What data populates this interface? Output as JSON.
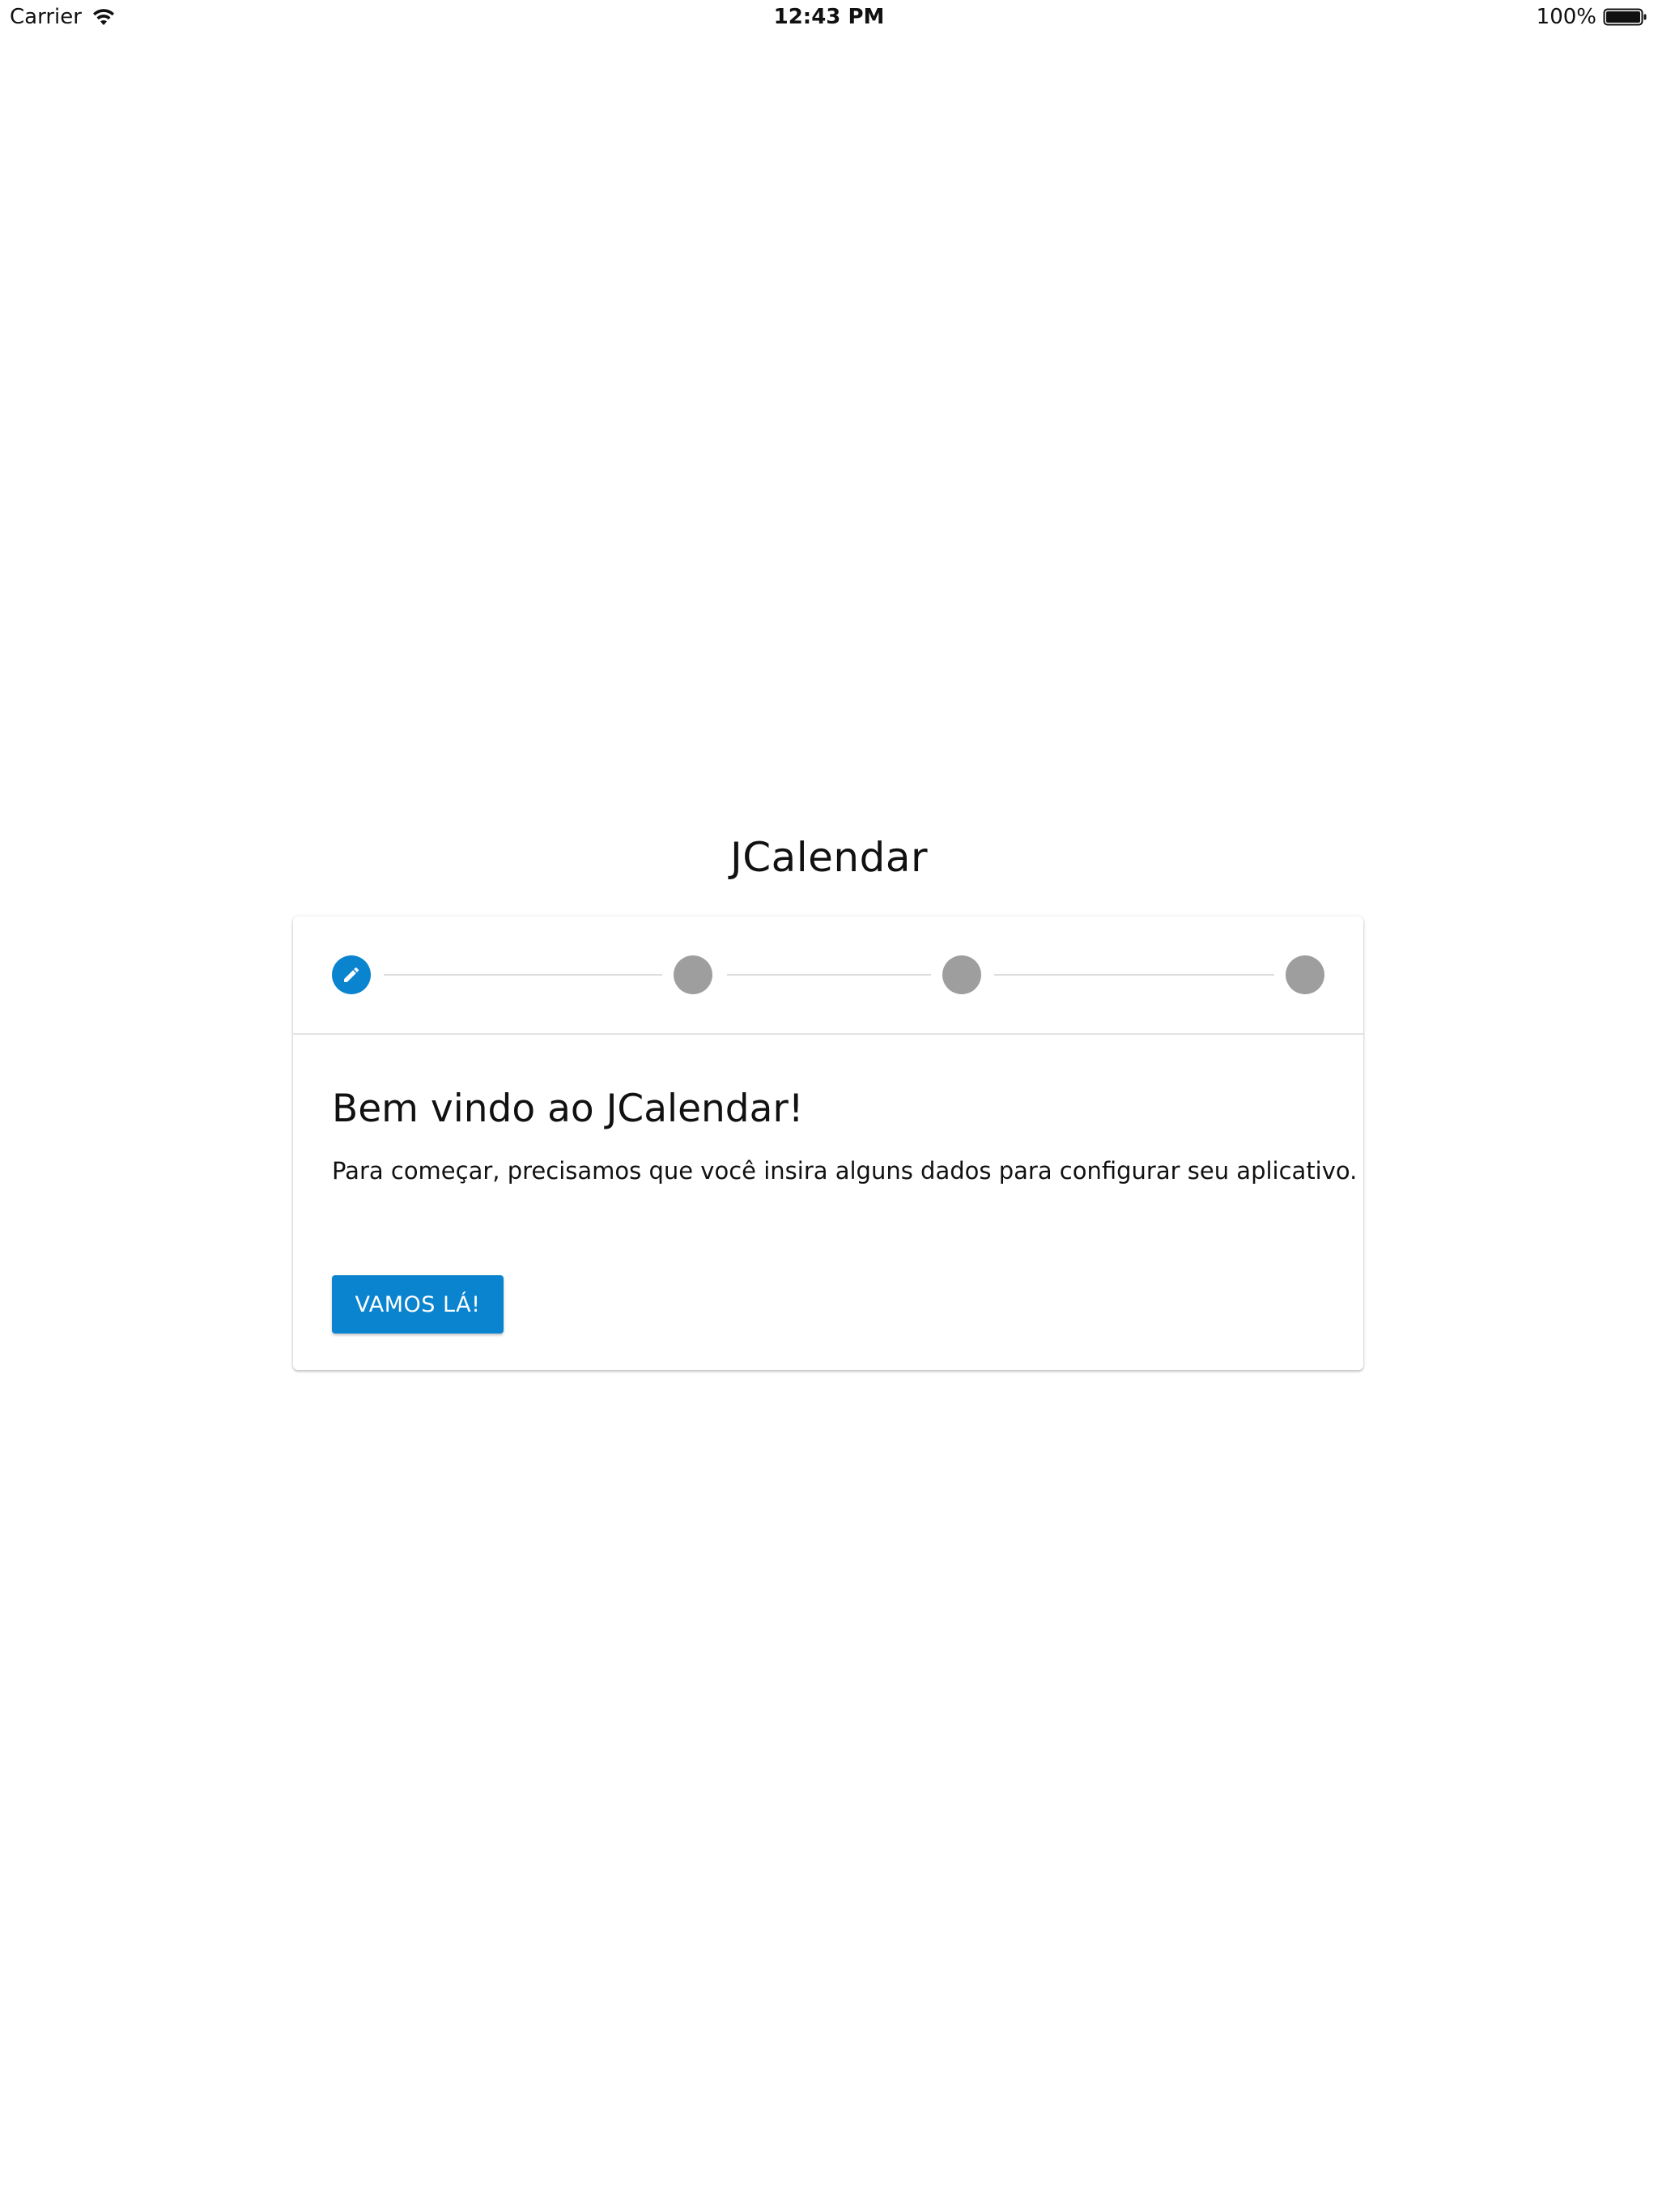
{
  "status_bar": {
    "carrier": "Carrier",
    "time": "12:43 PM",
    "battery": "100%"
  },
  "app": {
    "title": "JCalendar"
  },
  "stepper": {
    "steps": [
      {
        "state": "active",
        "icon": "pencil-icon"
      },
      {
        "state": "inactive"
      },
      {
        "state": "inactive"
      },
      {
        "state": "inactive"
      }
    ]
  },
  "welcome": {
    "heading": "Bem vindo ao JCalendar!",
    "text": "Para começar, precisamos que você insira alguns dados para configurar seu aplicativo.",
    "button_label": "VAMOS LÁ!"
  },
  "colors": {
    "accent": "#0a84cf",
    "step_inactive": "#9e9e9e",
    "divider": "#e3e3e3"
  }
}
